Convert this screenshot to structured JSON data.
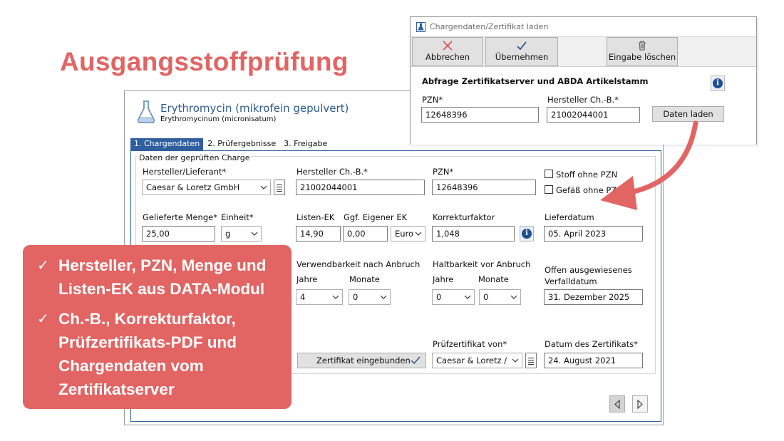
{
  "slide": {
    "title": "Ausgangsstoffprüfung"
  },
  "main": {
    "substance_name": "Erythromycin  (mikrofein gepulvert)",
    "substance_latin": "Erythromycinum (micronisatum)",
    "tabs": [
      {
        "label": "1. Chargendaten",
        "active": true
      },
      {
        "label": "2. Prüfergebnisse",
        "active": false
      },
      {
        "label": "3. Freigabe",
        "active": false
      }
    ],
    "group_title": "Daten der geprüften Charge",
    "manufacturer": {
      "label": "Hersteller/Lieferant*",
      "value": "Caesar & Loretz GmbH"
    },
    "batch": {
      "label": "Hersteller Ch.-B.*",
      "value": "21002044001"
    },
    "pzn": {
      "label": "PZN*",
      "value": "12648396"
    },
    "checkbox_substance_no_pzn": "Stoff ohne PZN",
    "checkbox_vessel_no_pzn": "Gefäß ohne PZN",
    "quantity": {
      "label": "Gelieferte Menge*",
      "value": "25,00"
    },
    "unit": {
      "label": "Einheit*",
      "value": "g"
    },
    "list_ek": {
      "label": "Listen-EK",
      "value": "14,90"
    },
    "own_ek": {
      "label": "Ggf. Eigener EK",
      "value": "0,00",
      "currency": "Euro"
    },
    "correction_factor": {
      "label": "Korrekturfaktor",
      "value": "1,048"
    },
    "delivery_date": {
      "label": "Lieferdatum",
      "value": "05. April 2023"
    },
    "usability_after_opening": {
      "label": "Verwendbarkeit nach Anbruch",
      "years_label": "Jahre",
      "months_label": "Monate",
      "years": "4",
      "months": "0"
    },
    "shelf_life_before_opening": {
      "label": "Haltbarkeit vor Anbruch",
      "years_label": "Jahre",
      "months_label": "Monate",
      "years": "0",
      "months": "0"
    },
    "expiry": {
      "label_line1": "Offen ausgewiesenes",
      "label_line2": "Verfalldatum",
      "value": "31. Dezember 2025"
    },
    "certificate_button": "Zertifikat eingebunden",
    "certificate_from": {
      "label": "Prüfzertifikat von*",
      "value": "Caesar & Loretz /"
    },
    "certificate_date": {
      "label": "Datum des Zertifikats*",
      "value": "24. August 2021"
    }
  },
  "dialog": {
    "title": "Chargendaten/Zertifikat laden",
    "toolbar": {
      "cancel": "Abbrechen",
      "accept": "Übernehmen",
      "clear": "Eingabe löschen"
    },
    "heading": "Abfrage Zertifikatserver und ABDA Artikelstamm",
    "pzn": {
      "label": "PZN*",
      "value": "12648396"
    },
    "batch": {
      "label": "Hersteller Ch.-B.*",
      "value": "21002044001"
    },
    "load_button": "Daten laden"
  },
  "callout": {
    "items": [
      {
        "check": "✓",
        "text": "Hersteller, PZN, Menge und Listen-EK aus DATA-Modul"
      },
      {
        "check": "✓",
        "text": "Ch.-B., Korrekturfaktor, Prüfzertifikats-PDF und Chargendaten vom Zertifikatserver"
      }
    ]
  },
  "colors": {
    "accent": "#e26463",
    "tab_active": "#2f5f9e",
    "info": "#1d4f91"
  }
}
